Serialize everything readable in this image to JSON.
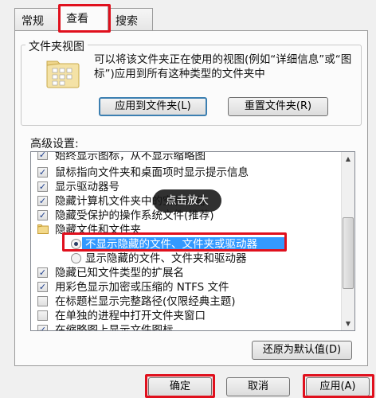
{
  "tabs": [
    {
      "label": "常规"
    },
    {
      "label": "查看"
    },
    {
      "label": "搜索"
    }
  ],
  "folder_views": {
    "group_title": "文件夹视图",
    "description": "可以将该文件夹正在使用的视图(例如“详细信息”或“图标”)应用到所有这种类型的文件夹中",
    "apply_button": "应用到文件夹(L)",
    "reset_button": "重置文件夹(R)"
  },
  "advanced": {
    "label": "高级设置:",
    "items": [
      {
        "type": "checkbox",
        "checked": true,
        "label": "始终显示图标，从不显示缩略图"
      },
      {
        "type": "checkbox",
        "checked": true,
        "label": "鼠标指向文件夹和桌面项时显示提示信息"
      },
      {
        "type": "checkbox",
        "checked": true,
        "label": "显示驱动器号"
      },
      {
        "type": "checkbox",
        "checked": true,
        "label": "隐藏计算机文件夹中的空驱动器"
      },
      {
        "type": "checkbox",
        "checked": true,
        "label": "隐藏受保护的操作系统文件(推荐)"
      },
      {
        "type": "folder",
        "label": "隐藏文件和文件夹"
      },
      {
        "type": "radio",
        "selected": true,
        "label": "不显示隐藏的文件、文件夹或驱动器"
      },
      {
        "type": "radio",
        "selected": false,
        "label": "显示隐藏的文件、文件夹和驱动器"
      },
      {
        "type": "checkbox",
        "checked": true,
        "label": "隐藏已知文件类型的扩展名"
      },
      {
        "type": "checkbox",
        "checked": true,
        "label": "用彩色显示加密或压缩的 NTFS 文件"
      },
      {
        "type": "checkbox",
        "checked": false,
        "label": "在标题栏显示完整路径(仅限经典主题)"
      },
      {
        "type": "checkbox",
        "checked": false,
        "label": "在单独的进程中打开文件夹窗口"
      },
      {
        "type": "checkbox",
        "checked": true,
        "label": "在缩略图上显示文件图标"
      }
    ],
    "restore_button": "还原为默认值(D)"
  },
  "overlay_label": "点击放大",
  "footer": {
    "ok": "确定",
    "cancel": "取消",
    "apply": "应用(A)"
  },
  "colors": {
    "highlight_box": "#e0101d",
    "selection": "#3399ff"
  }
}
